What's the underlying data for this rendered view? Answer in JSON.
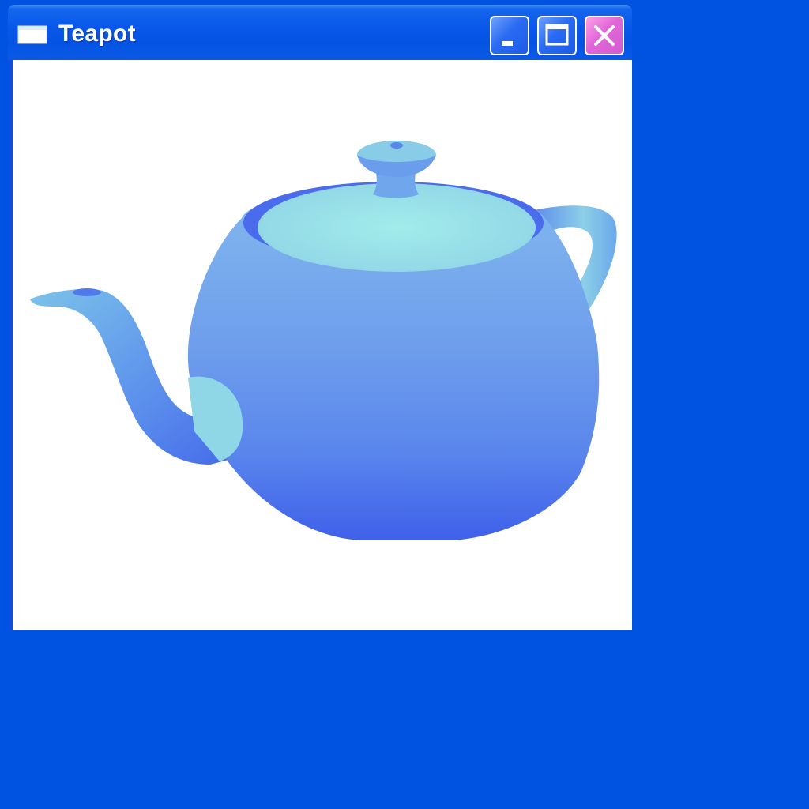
{
  "window": {
    "title": "Teapot"
  },
  "controls": {
    "minimize_icon": "minimize-icon",
    "maximize_icon": "maximize-icon",
    "close_icon": "close-icon"
  },
  "colors": {
    "desktop": "#0052e0",
    "titlebar": "#0a58ea",
    "close_button": "#e066d8",
    "teapot_light": "#9ee6e6",
    "teapot_body": "#6a9cec",
    "teapot_shadow": "#3e62ea"
  }
}
